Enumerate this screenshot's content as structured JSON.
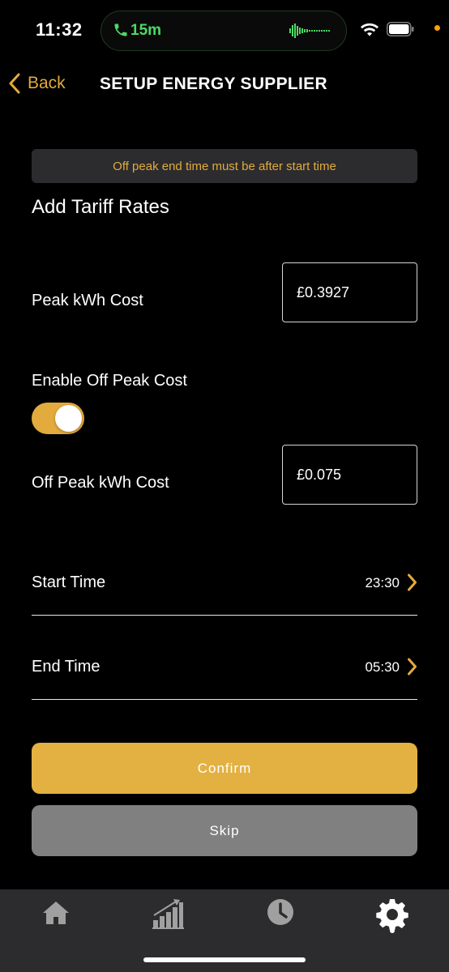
{
  "status_bar": {
    "time": "11:32",
    "call_duration": "15m",
    "call_icon": "phone-icon",
    "wifi_icon": "wifi-icon",
    "battery_icon": "battery-icon"
  },
  "nav": {
    "back_label": "Back",
    "title": "SETUP ENERGY SUPPLIER"
  },
  "error_banner": {
    "text": "Off peak end time must be after start time"
  },
  "form": {
    "section_title": "Add Tariff Rates",
    "peak_label": "Peak kWh Cost",
    "peak_value": "£0.3927",
    "enable_off_peak_label": "Enable Off Peak Cost",
    "enable_off_peak": true,
    "off_peak_label": "Off Peak kWh Cost",
    "off_peak_value": "£0.075",
    "start_time_label": "Start Time",
    "start_time_value": "23:30",
    "end_time_label": "End Time",
    "end_time_value": "05:30"
  },
  "buttons": {
    "confirm": "Confirm",
    "skip": "Skip"
  },
  "tab_bar": {
    "tabs": [
      {
        "icon": "home-icon",
        "active": false
      },
      {
        "icon": "bar-chart-icon",
        "active": false
      },
      {
        "icon": "clock-icon",
        "active": false
      },
      {
        "icon": "gear-icon",
        "active": true
      }
    ]
  },
  "colors": {
    "accent": "#e3aa3d",
    "confirm_button": "#e3b142",
    "skip_button": "#808080",
    "call_green": "#4cd964",
    "banner_bg": "#2c2c2e",
    "tab_bar_bg": "#2c2c2e",
    "inactive_icon": "#a0a0a0"
  }
}
